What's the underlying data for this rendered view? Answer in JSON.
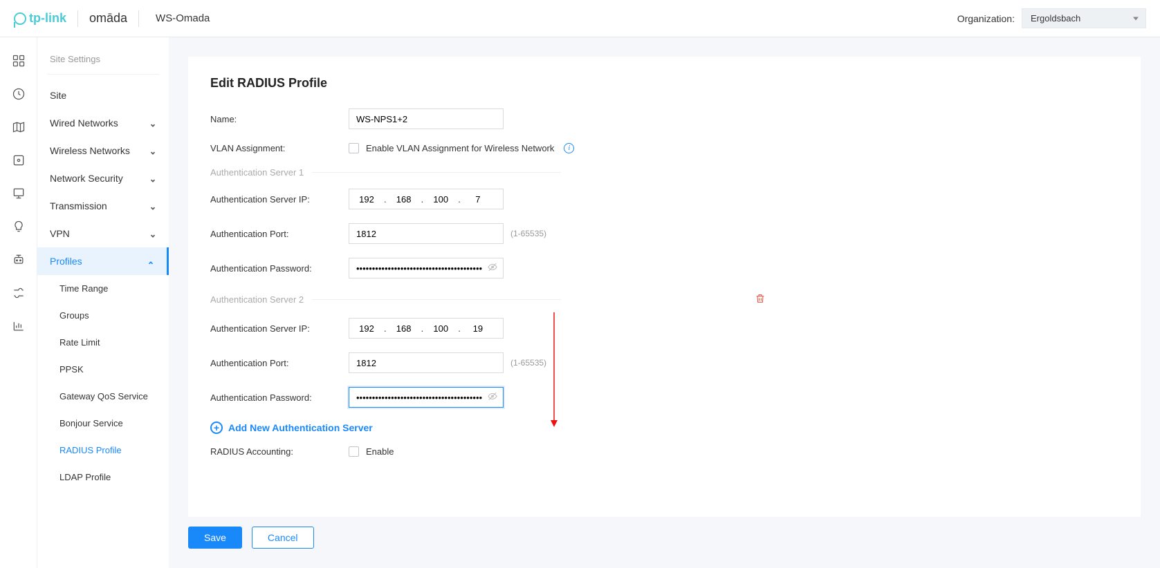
{
  "header": {
    "brand1": "tp-link",
    "brand2": "omāda",
    "app_name": "WS-Omada",
    "org_label": "Organization:",
    "org_value": "Ergoldsbach"
  },
  "sidebar": {
    "section_title": "Site Settings",
    "items": [
      {
        "label": "Site",
        "expandable": false
      },
      {
        "label": "Wired Networks",
        "expandable": true
      },
      {
        "label": "Wireless Networks",
        "expandable": true
      },
      {
        "label": "Network Security",
        "expandable": true
      },
      {
        "label": "Transmission",
        "expandable": true
      },
      {
        "label": "VPN",
        "expandable": true
      },
      {
        "label": "Profiles",
        "expandable": true,
        "active": true
      }
    ],
    "profiles_sub": [
      {
        "label": "Time Range"
      },
      {
        "label": "Groups"
      },
      {
        "label": "Rate Limit"
      },
      {
        "label": "PPSK"
      },
      {
        "label": "Gateway QoS Service"
      },
      {
        "label": "Bonjour Service"
      },
      {
        "label": "RADIUS Profile",
        "active": true
      },
      {
        "label": "LDAP Profile"
      }
    ]
  },
  "form": {
    "title": "Edit RADIUS Profile",
    "name_label": "Name:",
    "name_value": "WS-NPS1+2",
    "vlan_label": "VLAN Assignment:",
    "vlan_checkbox_text": "Enable VLAN Assignment for Wireless Network",
    "server1_heading": "Authentication Server 1",
    "server2_heading": "Authentication Server 2",
    "auth_ip_label": "Authentication Server IP:",
    "auth_port_label": "Authentication Port:",
    "auth_pass_label": "Authentication Password:",
    "port_hint": "(1-65535)",
    "server1": {
      "ip": [
        "192",
        "168",
        "100",
        "7"
      ],
      "port": "1812",
      "password": "••••••••••••••••••••••••••••••••••••••••"
    },
    "server2": {
      "ip": [
        "192",
        "168",
        "100",
        "19"
      ],
      "port": "1812",
      "password": "••••••••••••••••••••••••••••••••••••••••"
    },
    "add_server_link": "Add New Authentication Server",
    "accounting_label": "RADIUS Accounting:",
    "accounting_checkbox_text": "Enable",
    "save_label": "Save",
    "cancel_label": "Cancel"
  }
}
